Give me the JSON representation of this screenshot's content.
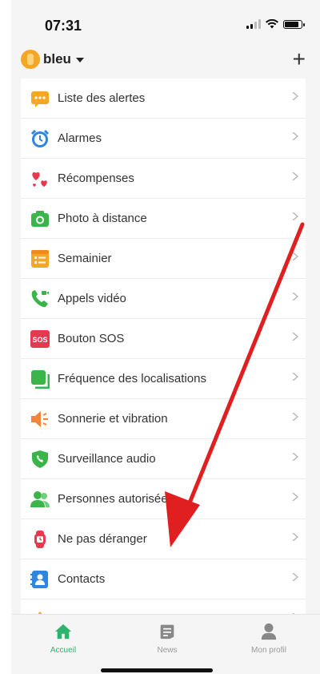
{
  "status_bar": {
    "time": "07:31"
  },
  "header": {
    "device_name": "bleu",
    "add_label": "+"
  },
  "menu": {
    "items": [
      {
        "label": "Liste des alertes",
        "icon": "alert-list-icon",
        "color": "#f5a623"
      },
      {
        "label": "Alarmes",
        "icon": "alarm-clock-icon",
        "color": "#2e86de"
      },
      {
        "label": "Récompenses",
        "icon": "hearts-icon",
        "color": "#e8384f"
      },
      {
        "label": "Photo à distance",
        "icon": "camera-icon",
        "color": "#3bb54a"
      },
      {
        "label": "Semainier",
        "icon": "schedule-icon",
        "color": "#f5a623"
      },
      {
        "label": "Appels vidéo",
        "icon": "video-call-icon",
        "color": "#3bb54a"
      },
      {
        "label": "Bouton SOS",
        "icon": "sos-icon",
        "color": "#e8384f",
        "icon_text": "SOS"
      },
      {
        "label": "Fréquence des localisations",
        "icon": "location-frequency-icon",
        "color": "#3bb54a"
      },
      {
        "label": "Sonnerie et vibration",
        "icon": "speaker-icon",
        "color": "#f5833b"
      },
      {
        "label": "Surveillance audio",
        "icon": "audio-monitor-icon",
        "color": "#3bb54a"
      },
      {
        "label": "Personnes autorisées",
        "icon": "authorized-people-icon",
        "color": "#3bb54a"
      },
      {
        "label": "Ne pas déranger",
        "icon": "do-not-disturb-watch-icon",
        "color": "#e8384f"
      },
      {
        "label": "Contacts",
        "icon": "contacts-icon",
        "color": "#2e86de"
      },
      {
        "label": "",
        "icon": "partial-item-icon",
        "color": "#f5a623"
      }
    ]
  },
  "tabbar": {
    "tabs": [
      {
        "label": "Accueil",
        "icon": "home-icon",
        "active": true
      },
      {
        "label": "News",
        "icon": "news-icon",
        "active": false
      },
      {
        "label": "Mon profil",
        "icon": "profile-icon",
        "active": false
      }
    ]
  },
  "colors": {
    "accent": "#2fb46e",
    "annotation_arrow": "#e02020"
  }
}
